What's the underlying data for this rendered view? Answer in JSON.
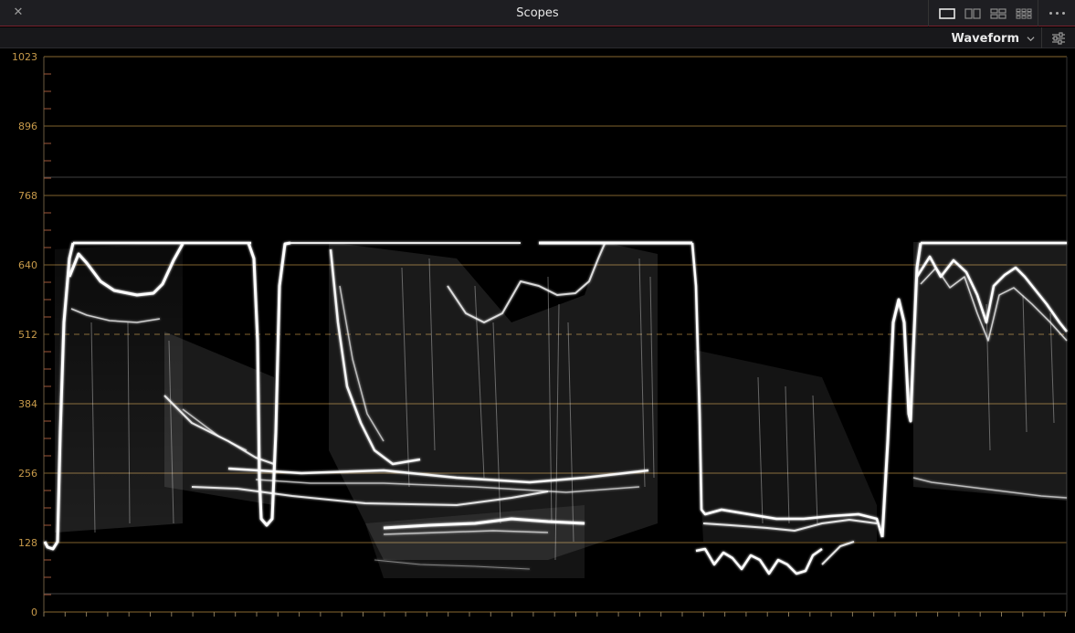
{
  "window": {
    "title": "Scopes"
  },
  "toolbar": {
    "scope_type": "Waveform",
    "layouts": [
      "single",
      "dual",
      "quad-2",
      "quad-4"
    ]
  },
  "scope": {
    "type": "waveform",
    "axis_labels": [
      "1023",
      "896",
      "768",
      "640",
      "512",
      "384",
      "256",
      "128",
      "0"
    ],
    "dashed_reference": "512",
    "colors": {
      "trace": "#ffffff",
      "grid": "#c79a4a",
      "background": "#000000"
    }
  }
}
